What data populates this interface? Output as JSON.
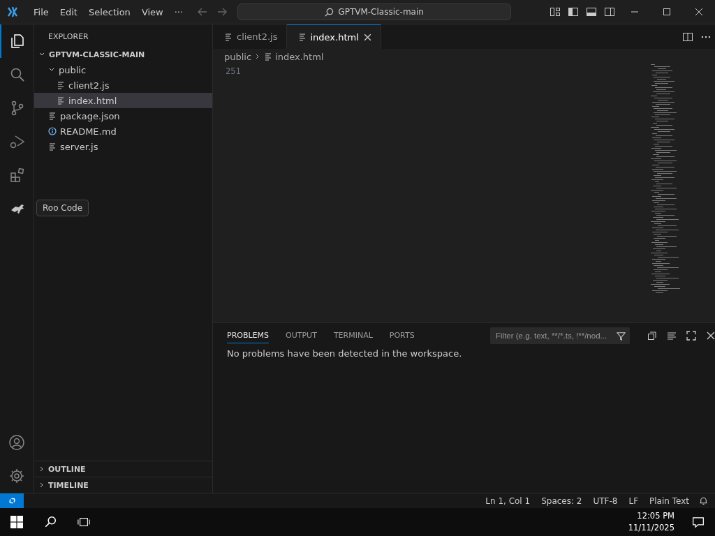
{
  "menu": [
    "File",
    "Edit",
    "Selection",
    "View",
    "···"
  ],
  "command_center": {
    "text": "GPTVM-Classic-main"
  },
  "activity_bar": [
    {
      "kind": "files",
      "selected": true
    },
    {
      "kind": "search",
      "selected": false
    },
    {
      "kind": "scm",
      "selected": false
    },
    {
      "kind": "debug",
      "selected": false
    },
    {
      "kind": "extensions",
      "selected": false
    },
    {
      "kind": "roo",
      "selected": false
    }
  ],
  "tooltip": "Roo Code",
  "explorer": {
    "title": "EXPLORER",
    "root": {
      "name": "GPTVM-CLASSIC-MAIN",
      "expanded": true,
      "children": [
        {
          "name": "public",
          "kind": "folder",
          "expanded": true,
          "selected": false,
          "children": [
            {
              "name": "client2.js",
              "kind": "file",
              "selected": false
            },
            {
              "name": "index.html",
              "kind": "file",
              "selected": true
            }
          ]
        },
        {
          "name": "package.json",
          "kind": "file",
          "selected": false
        },
        {
          "name": "README.md",
          "kind": "info",
          "selected": false
        },
        {
          "name": "server.js",
          "kind": "file",
          "selected": false
        }
      ]
    }
  },
  "sections": [
    {
      "name": "OUTLINE",
      "expanded": false
    },
    {
      "name": "TIMELINE",
      "expanded": false
    }
  ],
  "tabs": [
    {
      "label": "client2.js",
      "selected": false
    },
    {
      "label": "index.html",
      "selected": true
    }
  ],
  "breadcrumb": [
    "public",
    "index.html"
  ],
  "line_number": "251",
  "panel": {
    "tabs": [
      {
        "label": "PROBLEMS",
        "selected": true
      },
      {
        "label": "OUTPUT",
        "selected": false
      },
      {
        "label": "TERMINAL",
        "selected": false
      },
      {
        "label": "PORTS",
        "selected": false
      }
    ],
    "filter_placeholder": "Filter (e.g. text, **/*.ts, !**/nod...",
    "message": "No problems have been detected in the workspace."
  },
  "status_bar": [
    "Ln 1, Col 1",
    "Spaces: 2",
    "UTF-8",
    "LF",
    "Plain Text"
  ],
  "taskbar": {
    "time": "12:05 PM",
    "date": "11/11/2025"
  }
}
